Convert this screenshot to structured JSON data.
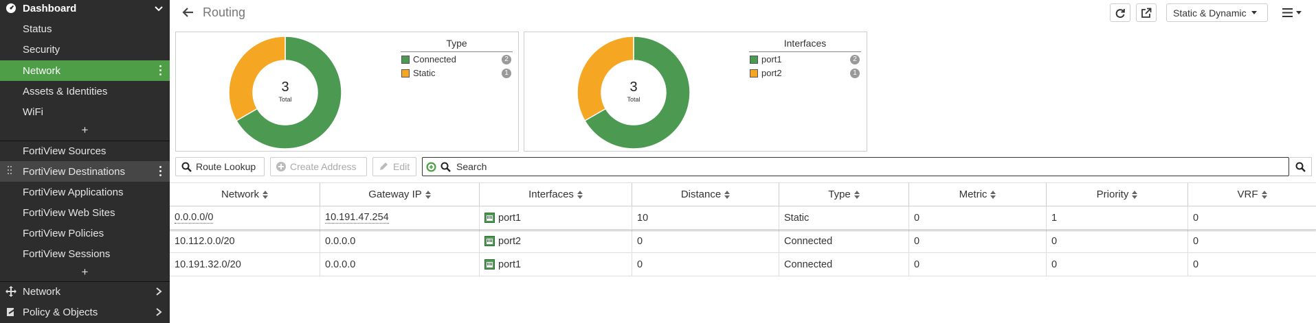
{
  "sidebar": {
    "dashboard_label": "Dashboard",
    "sub_items": [
      {
        "label": "Status"
      },
      {
        "label": "Security"
      },
      {
        "label": "Network"
      },
      {
        "label": "Assets & Identities"
      },
      {
        "label": "WiFi"
      }
    ],
    "add_label": "+",
    "fortiview_items": [
      {
        "label": "FortiView Sources"
      },
      {
        "label": "FortiView Destinations"
      },
      {
        "label": "FortiView Applications"
      },
      {
        "label": "FortiView Web Sites"
      },
      {
        "label": "FortiView Policies"
      },
      {
        "label": "FortiView Sessions"
      }
    ],
    "bottom_items": [
      {
        "label": "Network"
      },
      {
        "label": "Policy & Objects"
      }
    ]
  },
  "header": {
    "title": "Routing",
    "view_select": "Static & Dynamic"
  },
  "widgets": {
    "type": {
      "total": "3",
      "total_label": "Total",
      "legend_title": "Type",
      "items": [
        {
          "label": "Connected",
          "count": "2",
          "color": "#4c9a52"
        },
        {
          "label": "Static",
          "count": "1",
          "color": "#f5a623"
        }
      ]
    },
    "interfaces": {
      "total": "3",
      "total_label": "Total",
      "legend_title": "Interfaces",
      "items": [
        {
          "label": "port1",
          "count": "2",
          "color": "#4c9a52"
        },
        {
          "label": "port2",
          "count": "1",
          "color": "#f5a623"
        }
      ]
    }
  },
  "toolbar": {
    "route_lookup": "Route Lookup",
    "create_address": "Create Address",
    "edit": "Edit",
    "search_placeholder": "Search"
  },
  "table": {
    "columns": [
      "Network",
      "Gateway IP",
      "Interfaces",
      "Distance",
      "Type",
      "Metric",
      "Priority",
      "VRF"
    ],
    "rows": [
      {
        "network": "0.0.0.0/0",
        "gateway": "10.191.47.254",
        "interface": "port1",
        "distance": "10",
        "type": "Static",
        "metric": "0",
        "priority": "1",
        "vrf": "0"
      },
      {
        "network": "10.112.0.0/20",
        "gateway": "0.0.0.0",
        "interface": "port2",
        "distance": "0",
        "type": "Connected",
        "metric": "0",
        "priority": "0",
        "vrf": "0"
      },
      {
        "network": "10.191.32.0/20",
        "gateway": "0.0.0.0",
        "interface": "port1",
        "distance": "0",
        "type": "Connected",
        "metric": "0",
        "priority": "0",
        "vrf": "0"
      }
    ]
  },
  "colors": {
    "accent": "#4d9e47",
    "sidebar_bg": "#2d2d2d",
    "donut_green": "#4c9a52",
    "donut_orange": "#f5a623"
  }
}
